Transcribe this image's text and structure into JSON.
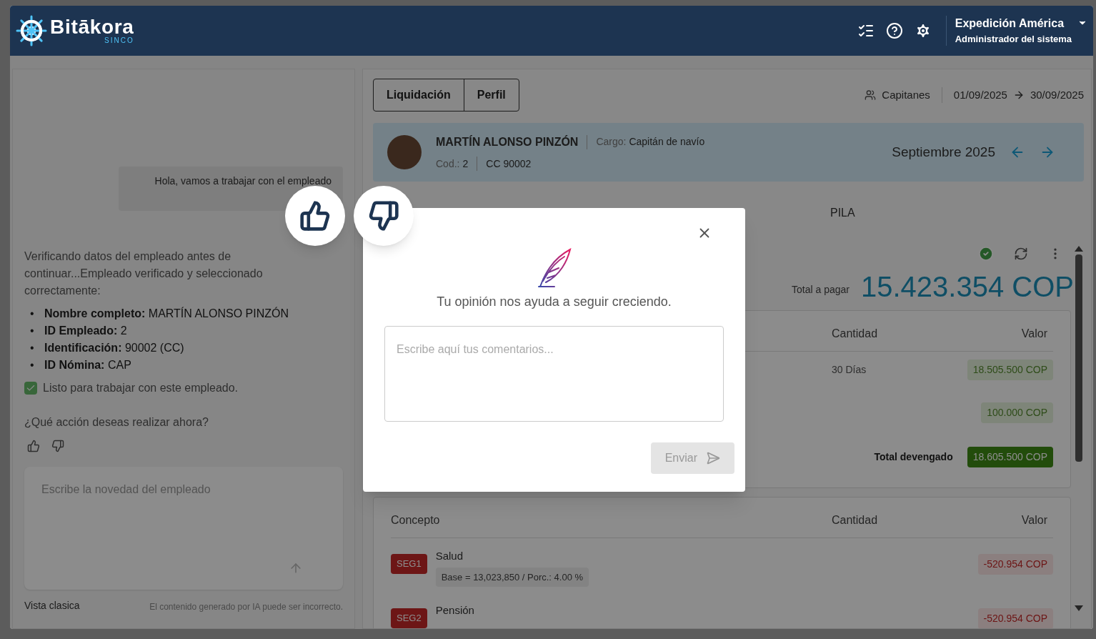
{
  "header": {
    "brand": "Bitākora",
    "brand_sub": "SINCO",
    "company": "Expedición América",
    "role": "Administrador del sistema"
  },
  "chat": {
    "user_message": "Hola, vamos a trabajar con el empleado",
    "intro": "Verificando datos del empleado antes de continuar...Empleado verificado y seleccionado correctamente:",
    "details": [
      {
        "marker": "•",
        "label": "Nombre completo:",
        "value": "MARTÍN ALONSO PINZÓN"
      },
      {
        "marker": "•",
        "label": "ID Empleado:",
        "value": "2"
      },
      {
        "marker": "•",
        "label": "Identificación:",
        "value": "90002 (CC)"
      },
      {
        "marker": "•",
        "label": "ID Nómina:",
        "value": "CAP"
      }
    ],
    "ready": {
      "text": "Listo para trabajar con este empleado.",
      "checked": true
    },
    "question": "¿Qué acción deseas realizar ahora?",
    "input_placeholder": "Escribe la novedad del empleado",
    "classic_link": "Vista clasica",
    "disclaimer": "El contenido generado por IA puede ser incorrecto."
  },
  "main": {
    "view_tabs": [
      {
        "label": "Liquidación"
      },
      {
        "label": "Perfil"
      }
    ],
    "group": "Capitanes",
    "date_from": "01/09/2025",
    "date_to": "30/09/2025",
    "employee": {
      "name": "MARTÍN ALONSO PINZÓN",
      "cargo_label": "Cargo:",
      "cargo": "Capitán de navío",
      "cod_label": "Cod.:",
      "cod": "2",
      "document": "CC 90002",
      "period": "Septiembre 2025"
    },
    "section_tabs": [
      {
        "label": "PILA"
      }
    ],
    "total_label": "Total a pagar",
    "total": "15.423.354 COP",
    "earnings": {
      "columns": [
        "Cantidad",
        "Valor"
      ],
      "rows": [
        {
          "quantity": "30 Días",
          "value": "18.505.500 COP"
        },
        {
          "value": "100.000 COP"
        }
      ],
      "total_label": "Total devengado",
      "total_value": "18.605.500 COP"
    },
    "deductions": {
      "columns": [
        "Concepto",
        "Cantidad",
        "Valor"
      ],
      "rows": [
        {
          "code": "SEG1",
          "name": "Salud",
          "detail": "Base = 13,023,850 / Porc.: 4.00 %",
          "value": "-520.954 COP"
        },
        {
          "code": "SEG2",
          "name": "Pensión",
          "value": "-520.954 COP"
        }
      ]
    }
  },
  "modal": {
    "message": "Tu opinión nos ayuda a seguir creciendo.",
    "placeholder": "Escribe aquí tus comentarios...",
    "submit": "Enviar",
    "submit_disabled": true
  }
}
